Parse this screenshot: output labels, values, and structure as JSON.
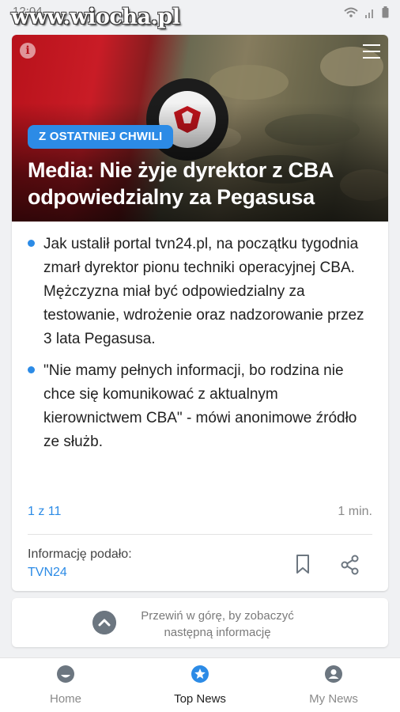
{
  "status_bar": {
    "time": "12:04",
    "watermark": "www.wiocha.pl"
  },
  "card": {
    "hero": {
      "badge": "Z OSTATNIEJ CHWILI",
      "headline": "Media: Nie żyje dyrektor z CBA odpowiedzialny za Pegasusa",
      "info_icon": "info-icon",
      "menu_icon": "menu-icon"
    },
    "bullets": [
      "Jak ustalił portal tvn24.pl, na początku tygodnia zmarł dyrektor pionu techniki operacyjnej CBA. Mężczyzna miał być odpowiedzialny za testowanie, wdrożenie oraz nadzorowanie przez 3 lata Pegasusa.",
      "\"Nie mamy pełnych informacji, bo rodzina nie chce się komunikować z aktualnym kierownictwem CBA\" - mówi anonimowe źródło ze służb."
    ],
    "pager": "1 z 11",
    "read_time": "1 min.",
    "source_label": "Informację podało:",
    "source_name": "TVN24"
  },
  "scroll_hint": {
    "text": "Przewiń w górę, by zobaczyć następną informację"
  },
  "nav": {
    "items": [
      {
        "label": "Home",
        "icon": "smile-icon",
        "active": false
      },
      {
        "label": "Top News",
        "icon": "star-icon",
        "active": true
      },
      {
        "label": "My News",
        "icon": "user-icon",
        "active": false
      }
    ]
  },
  "colors": {
    "accent": "#2c8be6",
    "headline": "#ffffff",
    "muted": "#8a8a8a"
  }
}
